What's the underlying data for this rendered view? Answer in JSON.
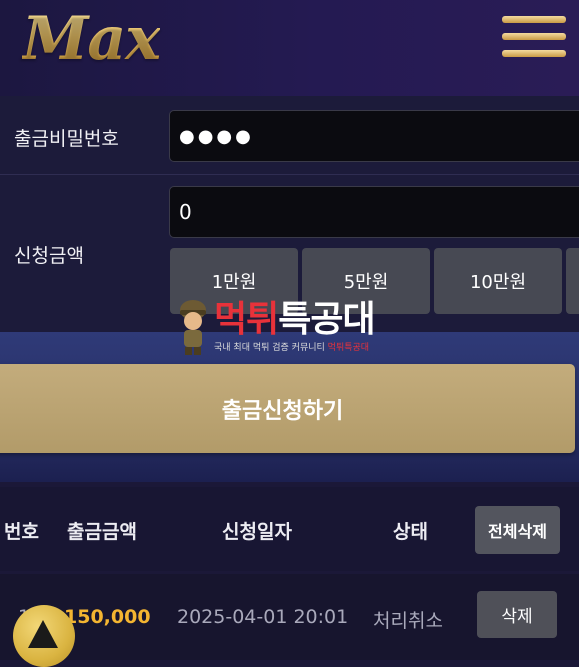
{
  "header": {
    "logo_text": "Max",
    "menu_icon": "hamburger-menu-icon"
  },
  "form": {
    "password_label": "출금비밀번호",
    "password_value": "●●●●",
    "amount_label": "신청금액",
    "amount_value": "0",
    "amount_buttons": [
      "1만원",
      "5만원",
      "10만원"
    ]
  },
  "watermark": {
    "title_part1": "먹튀",
    "title_part2": "특공대",
    "subtitle_part1": "국내 최대 먹튀 검증 커뮤니티 ",
    "subtitle_part2": "먹튀특공대"
  },
  "submit": {
    "label": "출금신청하기"
  },
  "table": {
    "headers": {
      "no": "번호",
      "amount": "출금금액",
      "date": "신청일자",
      "status": "상태",
      "delete_all": "전체삭제"
    },
    "rows": [
      {
        "no": "1",
        "amount": "150,000",
        "date": "2025-04-01 20:01",
        "status": "처리취소",
        "delete": "삭제"
      }
    ]
  },
  "colors": {
    "gold_accent": "#e7c067",
    "amount_highlight": "#f4b531",
    "submit_button": "#b8a170",
    "background": "#1b1838"
  },
  "scroll_top_icon": "arrow-up-icon"
}
